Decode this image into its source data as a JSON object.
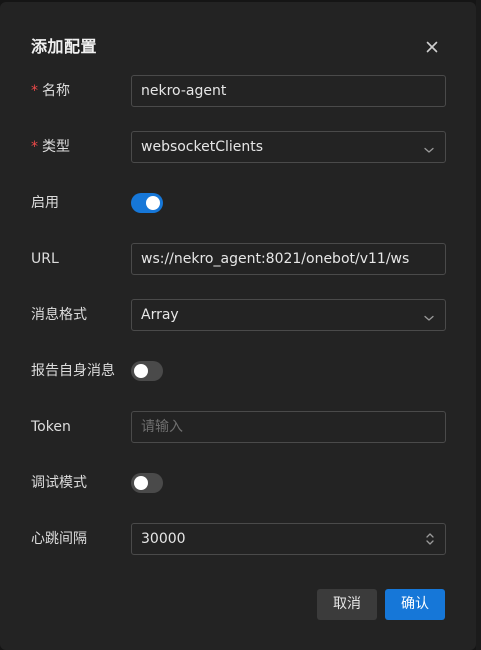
{
  "dialog": {
    "title": "添加配置",
    "close_icon": "close-icon"
  },
  "fields": {
    "name": {
      "label": "名称",
      "required_mark": "*",
      "value": "nekro-agent"
    },
    "type": {
      "label": "类型",
      "required_mark": "*",
      "value": "websocketClients",
      "icon": "chevron-down-icon"
    },
    "enabled": {
      "label": "启用",
      "state": true
    },
    "url": {
      "label": "URL",
      "value": "ws://nekro_agent:8021/onebot/v11/ws"
    },
    "message_format": {
      "label": "消息格式",
      "value": "Array",
      "icon": "chevron-down-icon"
    },
    "report_self": {
      "label": "报告自身消息",
      "state": false
    },
    "token": {
      "label": "Token",
      "placeholder": "请输入",
      "value": ""
    },
    "debug_mode": {
      "label": "调试模式",
      "state": false
    },
    "heartbeat": {
      "label": "心跳间隔",
      "value": "30000",
      "icon": "stepper-icon"
    }
  },
  "footer": {
    "cancel_label": "取消",
    "confirm_label": "确认"
  },
  "colors": {
    "accent": "#1677d8",
    "required": "#f04a4a",
    "dialog_bg": "#232323",
    "border": "#4a4a4a"
  }
}
